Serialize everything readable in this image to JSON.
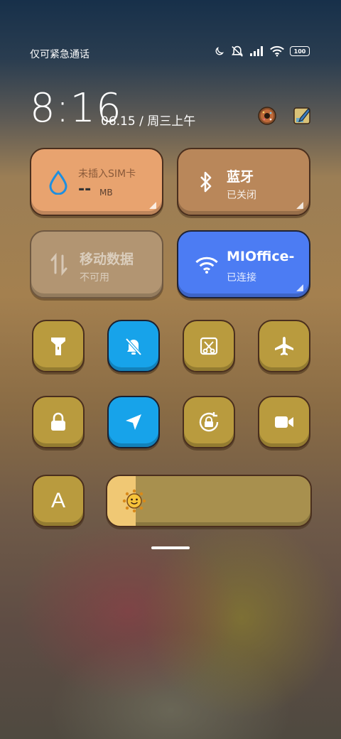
{
  "status_bar": {
    "carrier_text": "仅可紧急通话",
    "battery_level": "100",
    "icons": [
      "moon-icon",
      "mute-vibrate-icon",
      "signal-icon",
      "wifi-icon",
      "battery-icon"
    ]
  },
  "lock": {
    "time": "8:16",
    "date": "06.15",
    "separator": "/",
    "weekday": "周三上午",
    "top_icons": [
      "donut-icon",
      "sticky-note-icon"
    ]
  },
  "tiles": {
    "data_usage": {
      "title": "未插入SIM卡",
      "value": "--",
      "unit": "MB",
      "icon": "water-drop-icon"
    },
    "bluetooth": {
      "title": "蓝牙",
      "status": "已关闭",
      "icon": "bluetooth-icon"
    },
    "mobile_data": {
      "title": "移动数据",
      "status": "不可用",
      "icon": "data-arrows-icon"
    },
    "wifi": {
      "title": "MIOffice-",
      "status": "已连接",
      "icon": "wifi-icon"
    }
  },
  "toggles_row1": [
    {
      "name": "flashlight",
      "icon": "flashlight-icon",
      "active": false
    },
    {
      "name": "silent-mode",
      "icon": "bell-off-icon",
      "active": true
    },
    {
      "name": "screenshot",
      "icon": "scissors-icon",
      "active": false
    },
    {
      "name": "airplane-mode",
      "icon": "airplane-icon",
      "active": false
    }
  ],
  "toggles_row2": [
    {
      "name": "lock-screen",
      "icon": "lock-icon",
      "active": false
    },
    {
      "name": "location",
      "icon": "location-arrow-icon",
      "active": true
    },
    {
      "name": "rotation-lock",
      "icon": "rotation-lock-icon",
      "active": false
    },
    {
      "name": "screen-record",
      "icon": "video-camera-icon",
      "active": false
    }
  ],
  "bottom": {
    "auto_brightness_label": "A",
    "brightness_level": 0.14
  },
  "colors": {
    "data_tile": "#e8a36f",
    "bluetooth_tile": "#b9875a",
    "mobile_data_tile": "#b49876",
    "wifi_tile": "#4c7cf3",
    "toggle_active": "#17a3ea",
    "toggle_inactive": "#b99b3e"
  }
}
